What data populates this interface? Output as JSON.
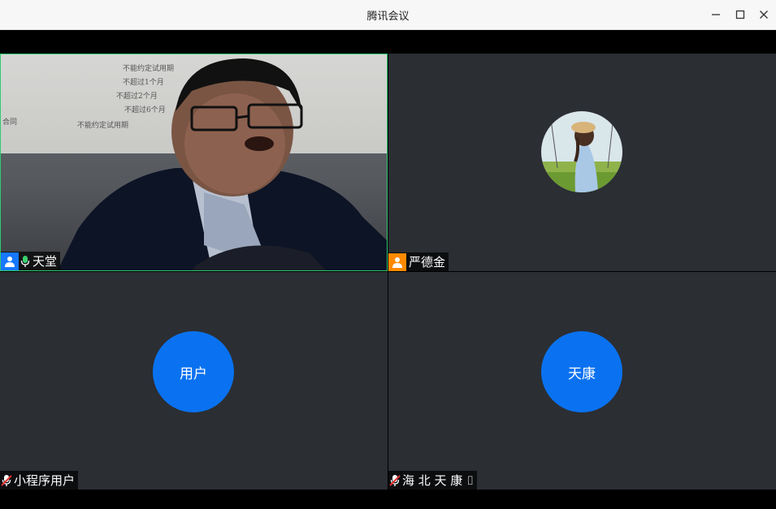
{
  "window": {
    "title": "腾讯会议"
  },
  "participants": [
    {
      "name": "天堂",
      "status": "video",
      "mic": "on",
      "role_badge": "user-icon",
      "role_color": "#1677ff"
    },
    {
      "name": "严德金",
      "status": "avatar-photo",
      "mic": "none",
      "role_badge": "user-icon",
      "role_color": "#ff8a00"
    },
    {
      "name": "小程序用户",
      "avatar_text": "用户",
      "status": "avatar",
      "mic": "muted"
    },
    {
      "name": "海 北 天 康 ⌷",
      "avatar_text": "天康",
      "status": "avatar",
      "mic": "muted"
    }
  ],
  "projector_text": [
    "不能约定试用期",
    "不超过1个月",
    "不超过2个月",
    "不超过6个月",
    "不能约定试用期",
    "合同"
  ],
  "colors": {
    "active_border": "#2ecc71",
    "avatar_bg": "#0a72f0",
    "tile_bg": "#2b2e33",
    "mic_on": "#3cd070",
    "mic_muted": "#e03030"
  }
}
